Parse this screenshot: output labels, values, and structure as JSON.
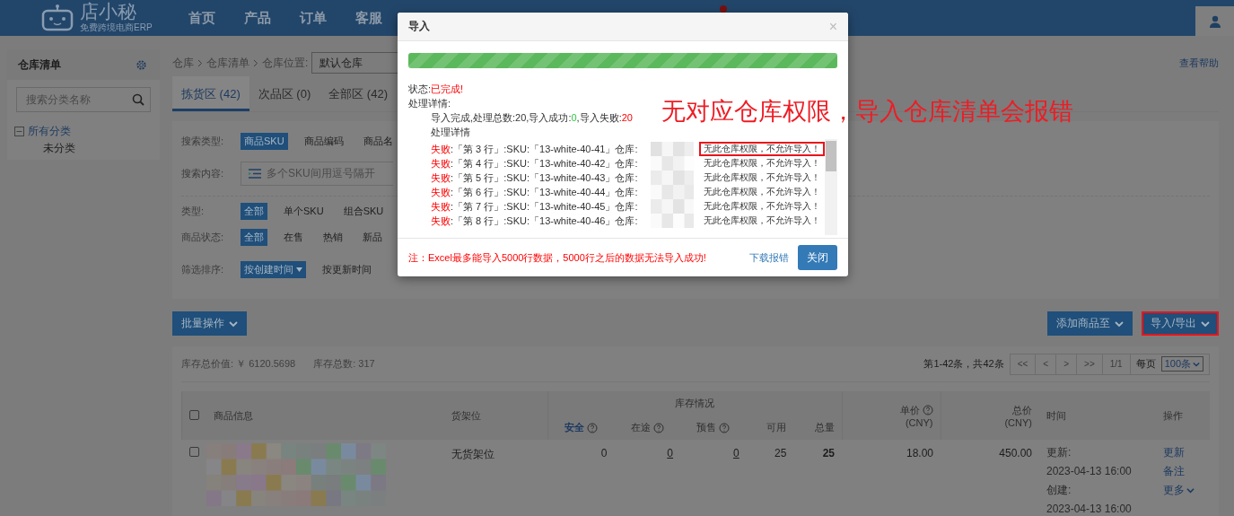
{
  "nav": {
    "logo": {
      "name": "店小秘",
      "tagline": "免费跨境电商ERP"
    },
    "items": [
      {
        "label": "首页",
        "selected": false
      },
      {
        "label": "产品",
        "selected": false
      },
      {
        "label": "订单",
        "selected": false
      },
      {
        "label": "客服",
        "selected": false
      }
    ]
  },
  "sidebar": {
    "title": "仓库清单",
    "search": {
      "placeholder": "搜索分类名称"
    },
    "tree": [
      {
        "label": "所有分类",
        "expanded": true,
        "children": [
          {
            "label": "未分类"
          }
        ]
      }
    ]
  },
  "breadcrumb": {
    "items": [
      "仓库",
      "仓库清单"
    ],
    "location_label": "仓库位置:",
    "location_value": "默认仓库"
  },
  "help_link": "查看帮助",
  "tabs": [
    {
      "label": "拣货区 (42)",
      "selected": true
    },
    {
      "label": "次品区 (0)",
      "selected": false
    },
    {
      "label": "全部区 (42)",
      "selected": false
    }
  ],
  "filters": [
    {
      "label": "搜索类型:",
      "kind": "options",
      "options": [
        {
          "label": "商品SKU",
          "selected": true
        },
        {
          "label": "商品编码",
          "selected": false
        },
        {
          "label": "商品名",
          "selected": false
        }
      ]
    },
    {
      "label": "搜索内容:",
      "kind": "field",
      "placeholder": "多个SKU间用逗号隔开"
    },
    {
      "label": "类型:",
      "kind": "options",
      "options": [
        {
          "label": "全部",
          "selected": true
        },
        {
          "label": "单个SKU",
          "selected": false
        },
        {
          "label": "组合SKU",
          "selected": false
        }
      ]
    },
    {
      "label": "商品状态:",
      "kind": "options",
      "options": [
        {
          "label": "全部",
          "selected": true
        },
        {
          "label": "在售",
          "selected": false
        },
        {
          "label": "热销",
          "selected": false
        },
        {
          "label": "新品",
          "selected": false
        }
      ]
    },
    {
      "label": "筛选排序:",
      "kind": "options",
      "options": [
        {
          "label": "按创建时间",
          "selected": true,
          "dropdown": true
        },
        {
          "label": "按更新时间",
          "selected": false,
          "dropdown": false
        }
      ]
    }
  ],
  "toolbar": {
    "left": [
      {
        "label": "批量操作",
        "highlighted": false
      }
    ],
    "right": [
      {
        "label": "添加商品至",
        "highlighted": false
      },
      {
        "label": "导入/导出",
        "highlighted": true
      }
    ]
  },
  "summary": {
    "value": "库存总价值: ￥ 6120.5698",
    "count": "库存总数: 317"
  },
  "pagination": {
    "range": "第1-42条，共42条",
    "buttons": [
      "<<",
      "<",
      ">",
      ">>",
      "1/1"
    ],
    "per_page_label": "每页",
    "per_page": "100条"
  },
  "table": {
    "select_all_checked": false,
    "columns": [
      {
        "label": "商品信息"
      },
      {
        "label": "货架位"
      },
      {
        "label": "库存情况",
        "sub": [
          {
            "label": "安全",
            "help": true,
            "link": true
          },
          {
            "label": "在途",
            "help": true,
            "link": false
          },
          {
            "label": "预售",
            "help": true,
            "link": false
          },
          {
            "label": "可用",
            "help": false,
            "link": false
          },
          {
            "label": "总量",
            "help": false,
            "link": false
          }
        ]
      },
      {
        "label": "单价",
        "unit": "(CNY)",
        "help": true
      },
      {
        "label": "总价",
        "unit": "(CNY)",
        "help": false
      },
      {
        "label": "时间"
      },
      {
        "label": "操作"
      }
    ],
    "rows": [
      {
        "checked": false,
        "shelf": "无货架位",
        "stock": [
          {
            "value": "0",
            "link": false,
            "bold": false
          },
          {
            "value": "0",
            "link": true,
            "bold": false
          },
          {
            "value": "0",
            "link": true,
            "bold": false
          },
          {
            "value": "25",
            "link": false,
            "bold": false
          },
          {
            "value": "25",
            "link": false,
            "bold": true
          }
        ],
        "unit_price": "18.00",
        "total": "450.00",
        "times": [
          "更新:",
          "2023-04-13 16:00",
          "创建:",
          "2023-04-13 16:00"
        ],
        "actions": [
          {
            "label": "更新",
            "caret": false
          },
          {
            "label": "备注",
            "caret": false
          },
          {
            "label": "更多",
            "caret": true
          }
        ]
      }
    ]
  },
  "modal": {
    "title": "导入",
    "close": "×",
    "progress": {
      "level": 1
    },
    "status_label": "状态:",
    "status": "已完成!",
    "details_label": "处理详情:",
    "result": {
      "text": "导入完成,处理总数:20,导入成功:",
      "success": "0",
      "fail_label": ",导入失败:",
      "fail": "20"
    },
    "sub_label": "处理详情",
    "log": [
      {
        "status": "失败",
        "text": ":「第 3 行」:SKU:「13-white-40-41」仓库:",
        "message": "无此仓库权限，不允许导入！",
        "highlighted": true
      },
      {
        "status": "失败",
        "text": ":「第 4 行」:SKU:「13-white-40-42」仓库:",
        "message": "无此仓库权限，不允许导入！",
        "highlighted": false
      },
      {
        "status": "失败",
        "text": ":「第 5 行」:SKU:「13-white-40-43」仓库:",
        "message": "无此仓库权限，不允许导入！",
        "highlighted": false
      },
      {
        "status": "失败",
        "text": ":「第 6 行」:SKU:「13-white-40-44」仓库:",
        "message": "无此仓库权限，不允许导入！",
        "highlighted": false
      },
      {
        "status": "失败",
        "text": ":「第 7 行」:SKU:「13-white-40-45」仓库:",
        "message": "无此仓库权限，不允许导入！",
        "highlighted": false
      },
      {
        "status": "失败",
        "text": ":「第 8 行」:SKU:「13-white-40-46」仓库:",
        "message": "无此仓库权限，不允许导入！",
        "highlighted": false
      }
    ],
    "note": "注：Excel最多能导入5000行数据，5000行之后的数据无法导入成功!",
    "download": "下载报错",
    "button": "关闭"
  },
  "annotation": "无对应仓库权限，导入仓库清单会报错"
}
